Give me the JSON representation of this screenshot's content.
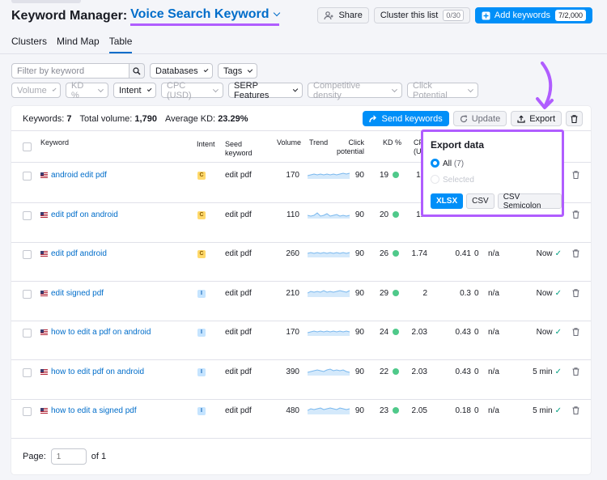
{
  "header": {
    "title": "Keyword Manager:",
    "project": "Voice Search Keyword",
    "share": "Share",
    "cluster": "Cluster this list",
    "cluster_count": "0/30",
    "add": "Add keywords",
    "add_count": "7/2,000"
  },
  "tabs": [
    "Clusters",
    "Mind Map",
    "Table"
  ],
  "filters": {
    "search_placeholder": "Filter by keyword",
    "databases": "Databases",
    "tags": "Tags",
    "row2": [
      "Volume",
      "KD %",
      "Intent",
      "CPC (USD)",
      "SERP Features",
      "Competitive density",
      "Click Potential"
    ]
  },
  "summary": {
    "keywords_label": "Keywords:",
    "keywords": "7",
    "volume_label": "Total volume:",
    "volume": "1,790",
    "kd_label": "Average KD:",
    "kd": "23.29%"
  },
  "toolbar": {
    "send": "Send keywords",
    "update": "Update",
    "export": "Export"
  },
  "columns": {
    "keyword": "Keyword",
    "intent": "Intent",
    "seed1": "Seed",
    "seed2": "keyword",
    "volume": "Volume",
    "trend": "Trend",
    "click1": "Click",
    "click2": "potential",
    "kd": "KD %",
    "cpc1": "CP",
    "cpc2": "(US"
  },
  "rows": [
    {
      "keyword": "android edit pdf",
      "intent": "C",
      "seed": "edit pdf",
      "volume": "170",
      "click": "90",
      "kd": "19",
      "cpc": "1.7",
      "com": "",
      "serp": "",
      "updated": ""
    },
    {
      "keyword": "edit pdf on android",
      "intent": "C",
      "seed": "edit pdf",
      "volume": "110",
      "click": "90",
      "kd": "20",
      "cpc": "1.8",
      "com": "",
      "serp": "",
      "updated": ""
    },
    {
      "keyword": "edit pdf android",
      "intent": "C",
      "seed": "edit pdf",
      "volume": "260",
      "click": "90",
      "kd": "26",
      "cpc": "1.74",
      "com": "0.41",
      "zero": "0",
      "serp": "n/a",
      "updated": "Now"
    },
    {
      "keyword": "edit signed pdf",
      "intent": "I",
      "seed": "edit pdf",
      "volume": "210",
      "click": "90",
      "kd": "29",
      "cpc": "2",
      "com": "0.3",
      "zero": "0",
      "serp": "n/a",
      "updated": "Now"
    },
    {
      "keyword": "how to edit a pdf on android",
      "intent": "I",
      "seed": "edit pdf",
      "volume": "170",
      "click": "90",
      "kd": "24",
      "cpc": "2.03",
      "com": "0.43",
      "zero": "0",
      "serp": "n/a",
      "updated": "Now"
    },
    {
      "keyword": "how to edit pdf on android",
      "intent": "I",
      "seed": "edit pdf",
      "volume": "390",
      "click": "90",
      "kd": "22",
      "cpc": "2.03",
      "com": "0.43",
      "zero": "0",
      "serp": "n/a",
      "updated": "5 min"
    },
    {
      "keyword": "how to edit a signed pdf",
      "intent": "I",
      "seed": "edit pdf",
      "volume": "480",
      "click": "90",
      "kd": "23",
      "cpc": "2.05",
      "com": "0.18",
      "zero": "0",
      "serp": "n/a",
      "updated": "5 min"
    }
  ],
  "footer": {
    "page_label": "Page:",
    "page_value": "1",
    "of": "of 1"
  },
  "export_popup": {
    "title": "Export data",
    "all": "All",
    "all_count": "(7)",
    "selected": "Selected",
    "formats": [
      "XLSX",
      "CSV",
      "CSV Semicolon"
    ]
  },
  "colors": {
    "accent": "#008ff8",
    "link": "#006dca",
    "highlight": "#b05dff",
    "kd_dot": "#4fc98a"
  }
}
